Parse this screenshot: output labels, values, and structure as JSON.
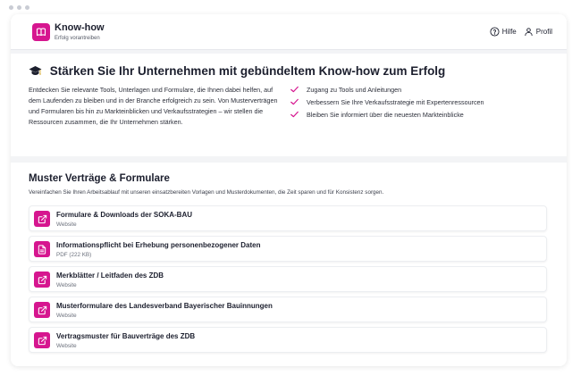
{
  "brand": {
    "title": "Know-how",
    "subtitle": "Erfolg vorantreiben",
    "accent": "#d6168f"
  },
  "nav": {
    "help_label": "Hilfe",
    "profile_label": "Profil"
  },
  "hero": {
    "title": "Stärken Sie Ihr Unternehmen mit gebündeltem Know-how zum Erfolg",
    "description": "Entdecken Sie relevante Tools, Unterlagen und Formulare, die Ihnen dabei helfen, auf dem Laufenden zu bleiben und in der Branche erfolgreich zu sein. Von Musterverträgen und Formularen bis hin zu Markteinblicken und Verkaufsstrategien – wir stellen die Ressourcen zusammen, die Ihr Unternehmen stärken.",
    "benefits": [
      "Zugang zu Tools und Anleitungen",
      "Verbessern Sie Ihre Verkaufsstrategie mit Expertenressourcen",
      "Bleiben Sie informiert über die neuesten Markteinblicke"
    ]
  },
  "section": {
    "title": "Muster Verträge & Formulare",
    "subtitle": "Vereinfachen Sie Ihren Arbeitsablauf mit unseren einsatzbereiten Vorlagen und Musterdokumenten, die Zeit sparen und für Konsistenz sorgen.",
    "items": [
      {
        "title": "Formulare & Downloads der SOKA-BAU",
        "type": "Website",
        "icon": "external-link-icon"
      },
      {
        "title": "Informationspflicht bei Erhebung personenbezogener Daten",
        "type": "PDF (222 KB)",
        "icon": "document-icon"
      },
      {
        "title": "Merkblätter / Leitfaden des ZDB",
        "type": "Website",
        "icon": "external-link-icon"
      },
      {
        "title": "Musterformulare des Landesverband Bayerischer Bauinnungen",
        "type": "Website",
        "icon": "external-link-icon"
      },
      {
        "title": "Vertragsmuster für Bauverträge des ZDB",
        "type": "Website",
        "icon": "external-link-icon"
      }
    ]
  }
}
